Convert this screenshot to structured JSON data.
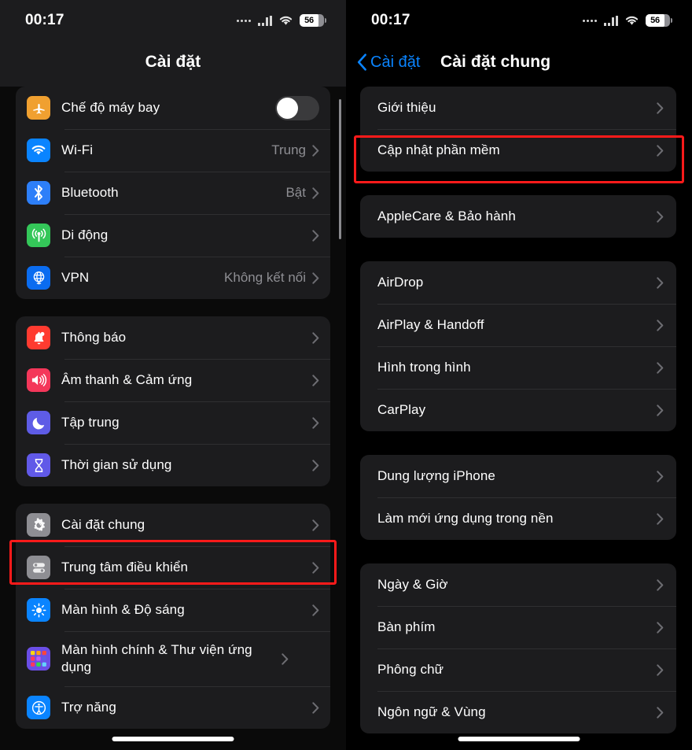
{
  "status_bar": {
    "time": "00:17",
    "battery_percent": "56",
    "signal_icon": "cellular-signal-icon",
    "wifi_icon": "wifi-icon",
    "battery_icon": "battery-icon"
  },
  "accent_colors": {
    "highlight_red": "#ff1a1a",
    "link_blue": "#0a84ff",
    "group_bg": "#1c1c1e",
    "secondary_text": "#8e8e93"
  },
  "left_screen": {
    "title": "Cài đặt",
    "groups": [
      {
        "rows": [
          {
            "label": "Chế độ máy bay",
            "icon": "airplane-icon",
            "icon_bg": "#f0a030",
            "control": "toggle",
            "toggle_on": false
          },
          {
            "label": "Wi-Fi",
            "icon": "wifi-icon",
            "icon_bg": "#0a84ff",
            "value": "Trung",
            "control": "chevron"
          },
          {
            "label": "Bluetooth",
            "icon": "bluetooth-icon",
            "icon_bg": "#2d7ff9",
            "value": "Bật",
            "control": "chevron"
          },
          {
            "label": "Di động",
            "icon": "cellular-icon",
            "icon_bg": "#34c759",
            "value": "",
            "control": "chevron"
          },
          {
            "label": "VPN",
            "icon": "vpn-globe-icon",
            "icon_bg": "#0a6cf0",
            "value": "Không kết nối",
            "control": "chevron"
          }
        ]
      },
      {
        "rows": [
          {
            "label": "Thông báo",
            "icon": "bell-icon",
            "icon_bg": "#ff3b30",
            "value": "",
            "control": "chevron"
          },
          {
            "label": "Âm thanh & Cảm ứng",
            "icon": "speaker-icon",
            "icon_bg": "#f4375a",
            "value": "",
            "control": "chevron"
          },
          {
            "label": "Tập trung",
            "icon": "moon-icon",
            "icon_bg": "#5e5ce6",
            "value": "",
            "control": "chevron"
          },
          {
            "label": "Thời gian sử dụng",
            "icon": "hourglass-icon",
            "icon_bg": "#6159e8",
            "value": "",
            "control": "chevron"
          }
        ]
      },
      {
        "rows": [
          {
            "label": "Cài đặt chung",
            "icon": "gear-icon",
            "icon_bg": "#8e8e93",
            "value": "",
            "control": "chevron",
            "highlighted": true
          },
          {
            "label": "Trung tâm điều khiển",
            "icon": "control-center-icon",
            "icon_bg": "#8e8e93",
            "value": "",
            "control": "chevron"
          },
          {
            "label": "Màn hình & Độ sáng",
            "icon": "brightness-icon",
            "icon_bg": "#0a84ff",
            "value": "",
            "control": "chevron"
          },
          {
            "label": "Màn hình chính & Thư viện ứng dụng",
            "icon": "app-library-icon",
            "icon_bg": "#6b4ee6",
            "value": "",
            "control": "chevron"
          },
          {
            "label": "Trợ năng",
            "icon": "accessibility-icon",
            "icon_bg": "#0a84ff",
            "value": "",
            "control": "chevron"
          }
        ]
      }
    ]
  },
  "right_screen": {
    "title": "Cài đặt chung",
    "back_label": "Cài đặt",
    "back_icon": "chevron-left-icon",
    "groups": [
      {
        "rows": [
          {
            "label": "Giới thiệu",
            "control": "chevron"
          },
          {
            "label": "Cập nhật phần mềm",
            "control": "chevron",
            "highlighted": true
          }
        ]
      },
      {
        "rows": [
          {
            "label": "AppleCare & Bảo hành",
            "control": "chevron"
          }
        ]
      },
      {
        "rows": [
          {
            "label": "AirDrop",
            "control": "chevron"
          },
          {
            "label": "AirPlay & Handoff",
            "control": "chevron"
          },
          {
            "label": "Hình trong hình",
            "control": "chevron"
          },
          {
            "label": "CarPlay",
            "control": "chevron"
          }
        ]
      },
      {
        "rows": [
          {
            "label": "Dung lượng iPhone",
            "control": "chevron"
          },
          {
            "label": "Làm mới ứng dụng trong nền",
            "control": "chevron"
          }
        ]
      },
      {
        "rows": [
          {
            "label": "Ngày & Giờ",
            "control": "chevron"
          },
          {
            "label": "Bàn phím",
            "control": "chevron"
          },
          {
            "label": "Phông chữ",
            "control": "chevron"
          },
          {
            "label": "Ngôn ngữ & Vùng",
            "control": "chevron"
          }
        ]
      }
    ]
  }
}
